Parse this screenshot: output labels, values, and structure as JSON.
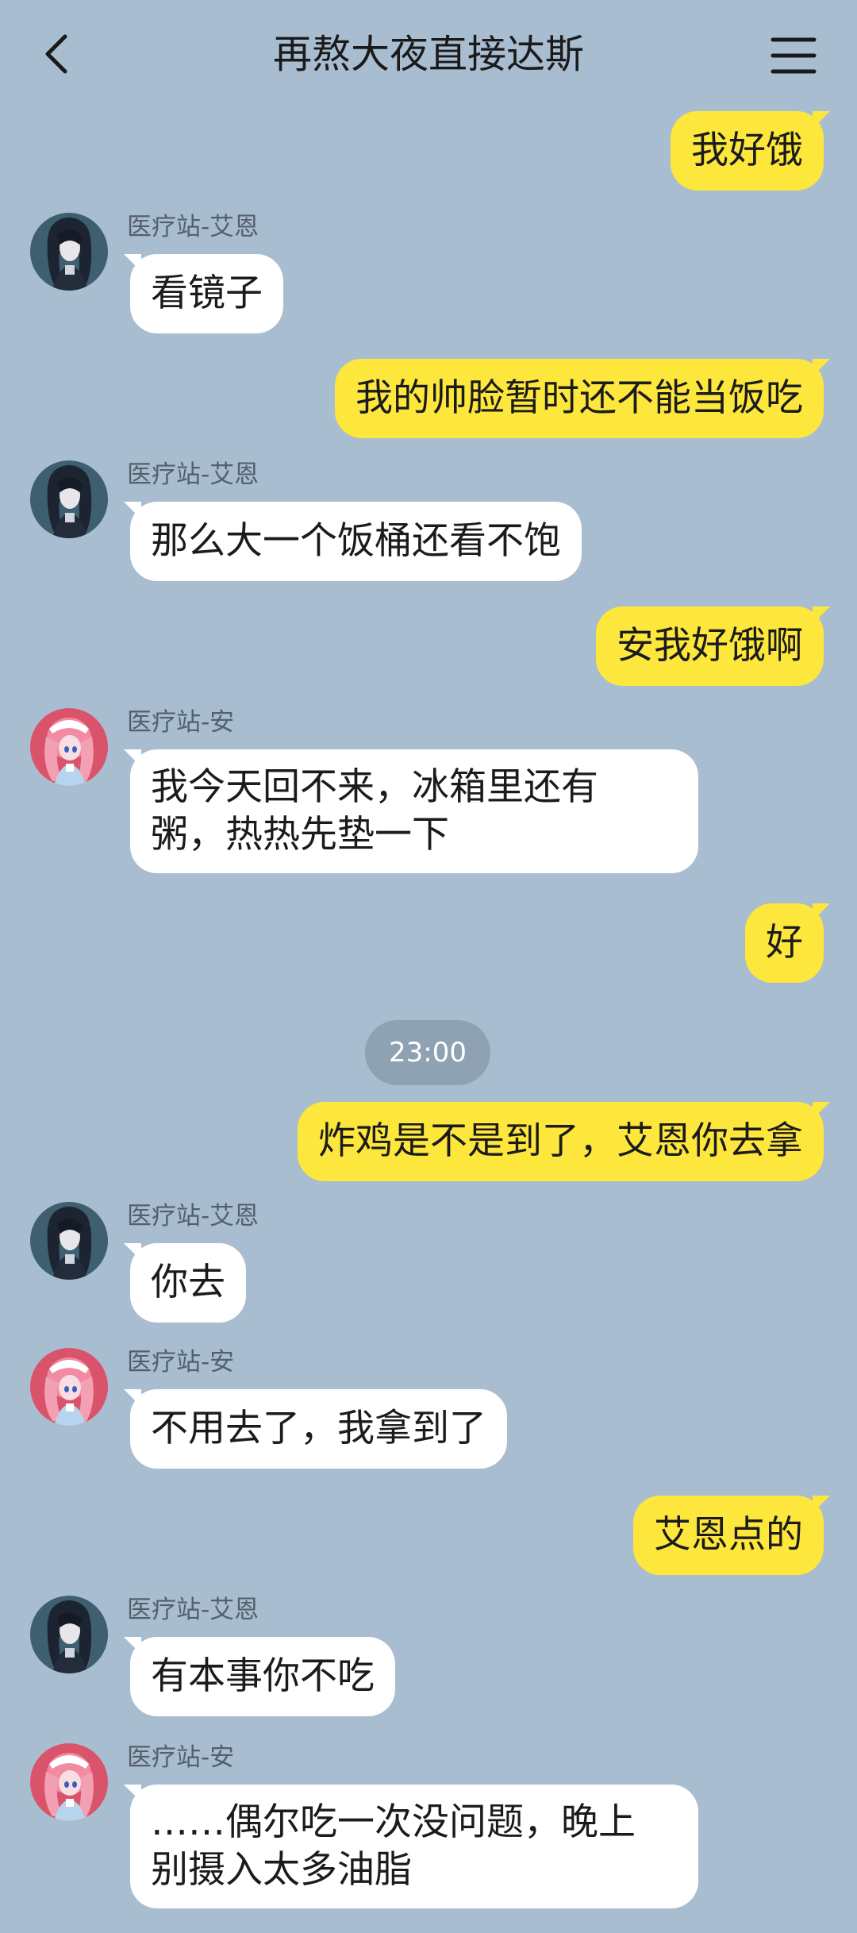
{
  "header": {
    "title": "再熬大夜直接达斯",
    "back_icon": "chevron-left-icon",
    "menu_icon": "hamburger-menu-icon"
  },
  "colors": {
    "background": "#a9bdd1",
    "my_bubble": "#fde73d",
    "other_bubble": "#ffffff",
    "time_chip": "#8fa2b4"
  },
  "messages": [
    {
      "side": "me",
      "text": "我好饿"
    },
    {
      "side": "other",
      "sender": "医疗站-艾恩",
      "avatar": "dark-hair-avatar",
      "text": "看镜子"
    },
    {
      "side": "me",
      "text": "我的帅脸暂时还不能当饭吃"
    },
    {
      "side": "other",
      "sender": "医疗站-艾恩",
      "avatar": "dark-hair-avatar",
      "text": "那么大一个饭桶还看不饱"
    },
    {
      "side": "me",
      "text": "安我好饿啊"
    },
    {
      "side": "other",
      "sender": "医疗站-安",
      "avatar": "pink-hair-nurse-avatar",
      "text_lines": [
        "我今天回不来，冰箱里还有",
        "粥，热热先垫一下"
      ]
    },
    {
      "side": "me",
      "text": "好"
    },
    {
      "side": "time",
      "text": "23:00"
    },
    {
      "side": "me",
      "text": "炸鸡是不是到了，艾恩你去拿"
    },
    {
      "side": "other",
      "sender": "医疗站-艾恩",
      "avatar": "dark-hair-avatar",
      "text": "你去"
    },
    {
      "side": "other",
      "sender": "医疗站-安",
      "avatar": "pink-hair-nurse-avatar",
      "text": "不用去了，我拿到了"
    },
    {
      "side": "me",
      "text": "艾恩点的"
    },
    {
      "side": "other",
      "sender": "医疗站-艾恩",
      "avatar": "dark-hair-avatar",
      "text": "有本事你不吃"
    },
    {
      "side": "other",
      "sender": "医疗站-安",
      "avatar": "pink-hair-nurse-avatar",
      "text_lines": [
        "……偶尔吃一次没问题，晚上",
        "别摄入太多油脂"
      ]
    }
  ]
}
